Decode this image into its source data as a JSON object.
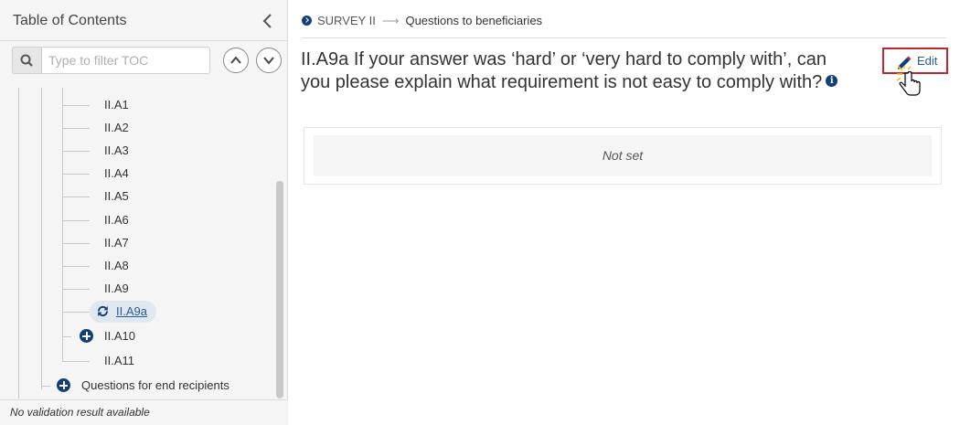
{
  "sidebar": {
    "title": "Table of Contents",
    "filter_placeholder": "Type to filter TOC",
    "items": [
      {
        "label": "II.A1"
      },
      {
        "label": "II.A2"
      },
      {
        "label": "II.A3"
      },
      {
        "label": "II.A4"
      },
      {
        "label": "II.A5"
      },
      {
        "label": "II.A6"
      },
      {
        "label": "II.A7"
      },
      {
        "label": "II.A8"
      },
      {
        "label": "II.A9"
      },
      {
        "label": "II.A9a",
        "selected": true,
        "icon": "refresh-icon"
      },
      {
        "label": "II.A10",
        "icon": "expand-plus-icon"
      },
      {
        "label": "II.A11"
      },
      {
        "label": "Questions for end recipients",
        "icon": "expand-plus-icon"
      }
    ],
    "footer": "No validation result available"
  },
  "breadcrumb": {
    "section": "SURVEY II",
    "current": "Questions to beneficiaries"
  },
  "question": {
    "title": "II.A9a If your answer was ‘hard’ or ‘very hard to comply with’, can you please explain what requirement is not easy to comply with?",
    "answer": "Not set"
  },
  "toolbar": {
    "edit_label": "Edit"
  },
  "colors": {
    "accent": "#123f7a",
    "highlight_border": "#c0272d",
    "selected_bg": "#dfe7f1"
  }
}
